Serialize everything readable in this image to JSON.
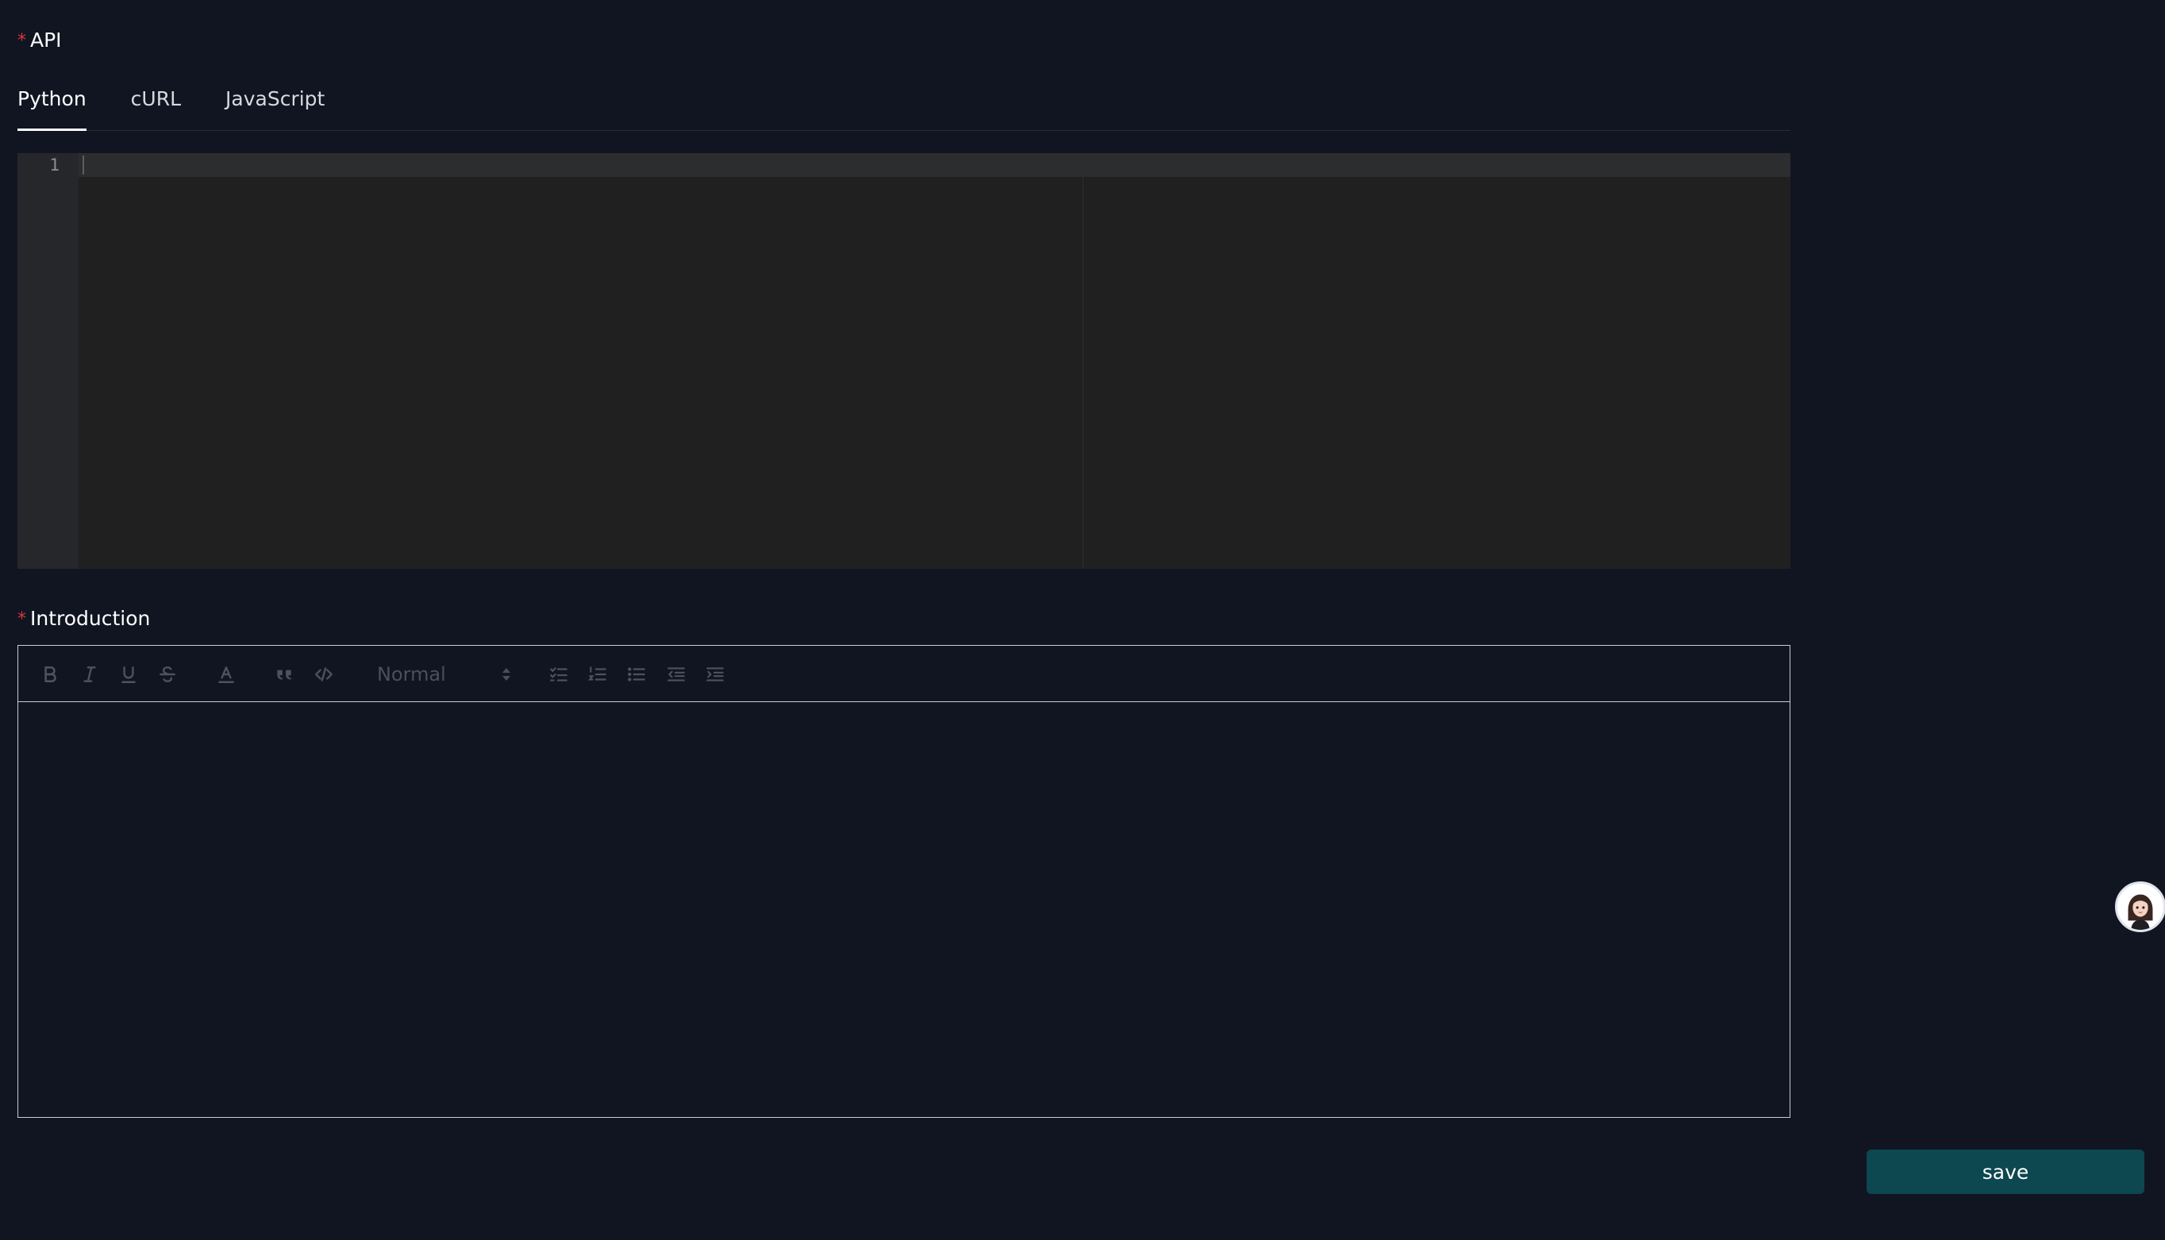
{
  "api_field": {
    "required_mark": "*",
    "label": "API",
    "tabs": [
      {
        "label": "Python",
        "active": true
      },
      {
        "label": "cURL",
        "active": false
      },
      {
        "label": "JavaScript",
        "active": false
      }
    ],
    "code_editor": {
      "line_numbers": [
        "1"
      ],
      "content": ""
    }
  },
  "introduction_field": {
    "required_mark": "*",
    "label": "Introduction",
    "toolbar": {
      "heading_select_value": "Normal",
      "buttons": [
        "bold-icon",
        "italic-icon",
        "underline-icon",
        "strikethrough-icon",
        "text-color-icon",
        "blockquote-icon",
        "code-icon",
        "checklist-icon",
        "ordered-list-icon",
        "bullet-list-icon",
        "outdent-icon",
        "indent-icon"
      ]
    },
    "content": ""
  },
  "save_button": {
    "label": "save",
    "color": "#0d4750"
  },
  "colors": {
    "background": "#111522",
    "required": "#d9363e",
    "editor_bg": "#202020"
  }
}
